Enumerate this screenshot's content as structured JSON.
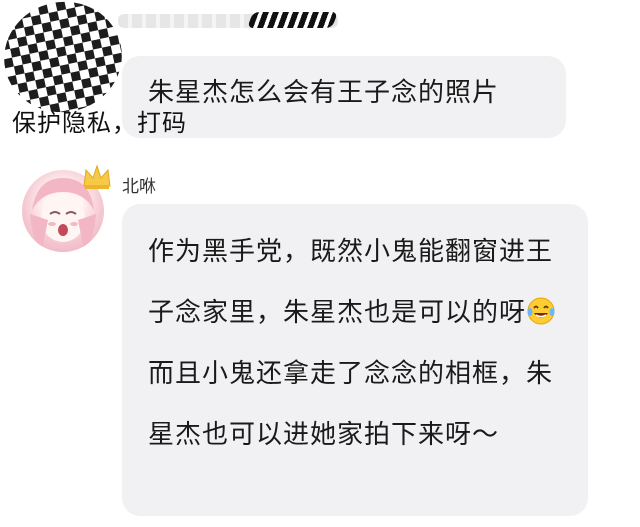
{
  "messages": [
    {
      "sender_name": "",
      "text": "朱星杰怎么会有王子念的照片"
    },
    {
      "sender_name": "北咻",
      "text_part1": "作为黑手党，既然小鬼能翻窗进王子念家里，朱星杰也是可以的呀",
      "emoji": "laughing-crying-emoji",
      "text_part2": "而且小鬼还拿走了念念的相框，朱星杰也可以进她家拍下来呀～"
    }
  ],
  "overlay_caption": "保护隐私，打码"
}
